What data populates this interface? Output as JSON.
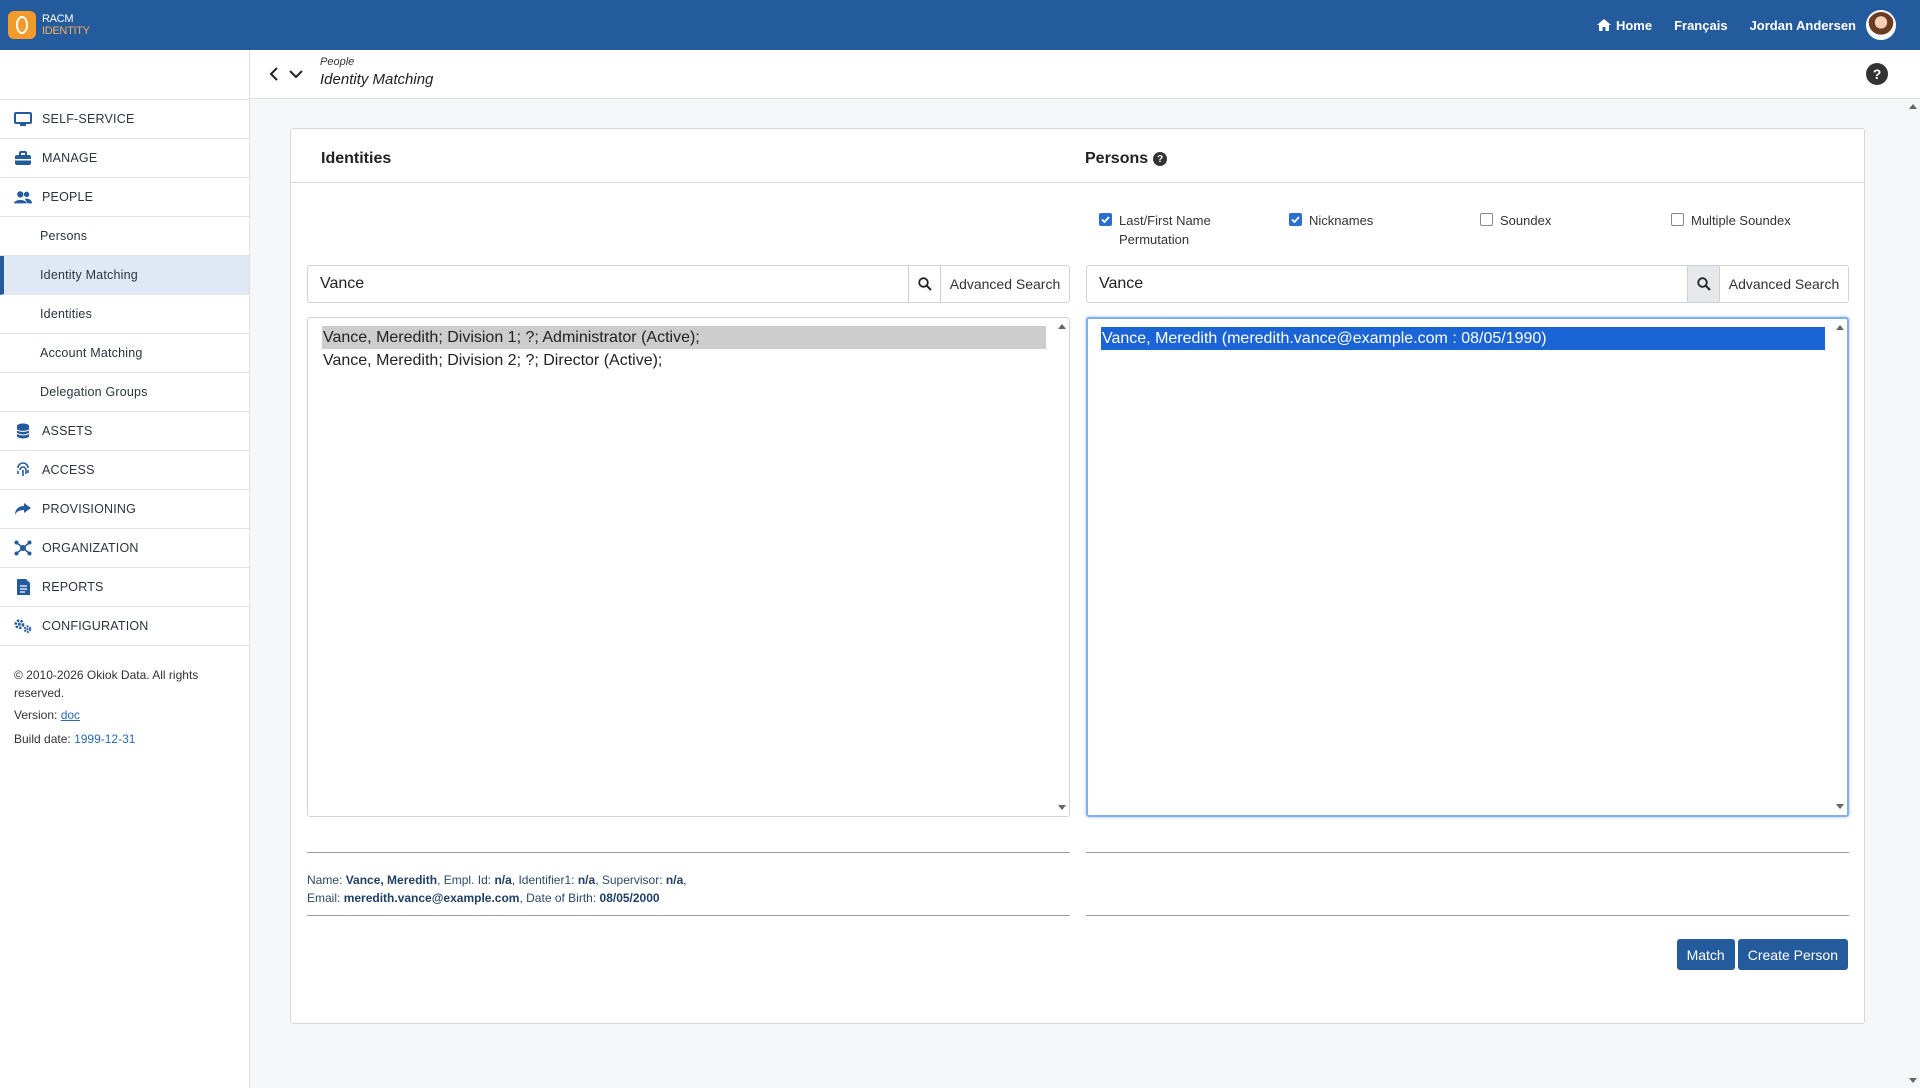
{
  "header": {
    "logo_line1": "RACM",
    "logo_line2": "IDENTITY",
    "home_label": "Home",
    "language_label": "Français",
    "user_name": "Jordan Andersen"
  },
  "sidebar": {
    "items": [
      {
        "label": "SELF-SERVICE",
        "icon": "monitor-icon"
      },
      {
        "label": "MANAGE",
        "icon": "toolbox-icon"
      },
      {
        "label": "PEOPLE",
        "icon": "users-icon"
      },
      {
        "label": "Persons"
      },
      {
        "label": "Identity Matching"
      },
      {
        "label": "Identities"
      },
      {
        "label": "Account Matching"
      },
      {
        "label": "Delegation Groups"
      },
      {
        "label": "ASSETS",
        "icon": "database-icon"
      },
      {
        "label": "ACCESS",
        "icon": "fingerprint-icon"
      },
      {
        "label": "PROVISIONING",
        "icon": "share-icon"
      },
      {
        "label": "ORGANIZATION",
        "icon": "network-icon"
      },
      {
        "label": "REPORTS",
        "icon": "report-icon"
      },
      {
        "label": "CONFIGURATION",
        "icon": "gears-icon"
      }
    ],
    "footer": {
      "copyright": "© 2010-2026 Okiok Data. All rights reserved.",
      "version_label": "Version:",
      "version_link": "doc",
      "build_label": "Build date:",
      "build_date": "1999-12-31"
    }
  },
  "breadcrumb": {
    "parent": "People",
    "title": "Identity Matching"
  },
  "identities": {
    "heading": "Identities",
    "search_value": "Vance",
    "advanced_label": "Advanced Search",
    "options": [
      "Vance, Meredith; Division 1; ?; Administrator (Active);",
      "Vance, Meredith; Division 2; ?; Director (Active);"
    ],
    "details": {
      "name_label": "Name:",
      "name": "Vance, Meredith",
      "empl_label": "Empl. Id:",
      "empl": "n/a",
      "ident_label": "Identifier1:",
      "ident": "n/a",
      "supervisor_label": "Supervisor:",
      "supervisor": "n/a",
      "email_label": "Email:",
      "email": "meredith.vance@example.com",
      "dob_label": "Date of Birth:",
      "dob": "08/05/2000"
    }
  },
  "persons": {
    "heading": "Persons",
    "checks": [
      {
        "label": "Last/First Name Permutation",
        "checked": true
      },
      {
        "label": "Nicknames",
        "checked": true
      },
      {
        "label": "Soundex",
        "checked": false
      },
      {
        "label": "Multiple Soundex",
        "checked": false
      }
    ],
    "search_value": "Vance",
    "advanced_label": "Advanced Search",
    "options": [
      "Vance, Meredith (meredith.vance@example.com : 08/05/1990)"
    ]
  },
  "actions": {
    "match_label": "Match",
    "create_label": "Create Person"
  }
}
